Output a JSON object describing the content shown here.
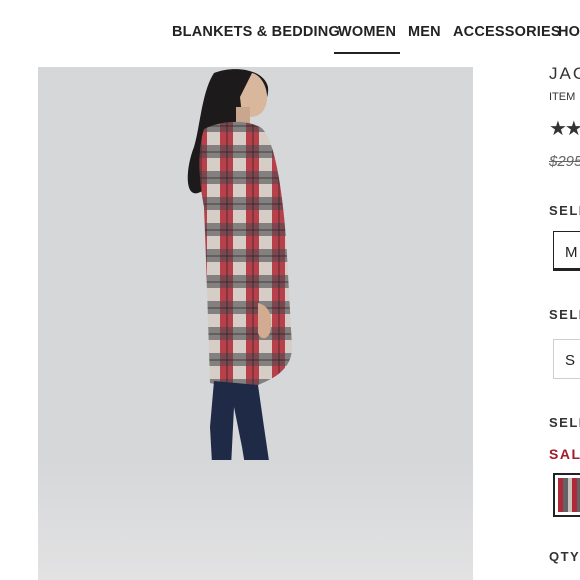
{
  "nav": {
    "items": [
      {
        "label": "BLANKETS & BEDDING",
        "active": false
      },
      {
        "label": "WOMEN",
        "active": true
      },
      {
        "label": "MEN",
        "active": false
      },
      {
        "label": "ACCESSORIES",
        "active": false
      },
      {
        "label": "HO",
        "active": false
      }
    ]
  },
  "product": {
    "image_alt": "Model wearing red and grey plaid shirt jacket with jeans and ankle boots",
    "title": "JAC",
    "item_number": "ITEM",
    "stars": "★★",
    "price_original": "$295"
  },
  "options": {
    "size_label_1": "SELE",
    "size_value_1": "M",
    "size_label_2": "SELE",
    "size_value_2": "S",
    "color_label": "SELE",
    "sale_label": "SALE",
    "qty_label": "QTY"
  },
  "colors": {
    "accent": "#a01c2a",
    "text": "#222222",
    "background": "#d6d7d9"
  }
}
